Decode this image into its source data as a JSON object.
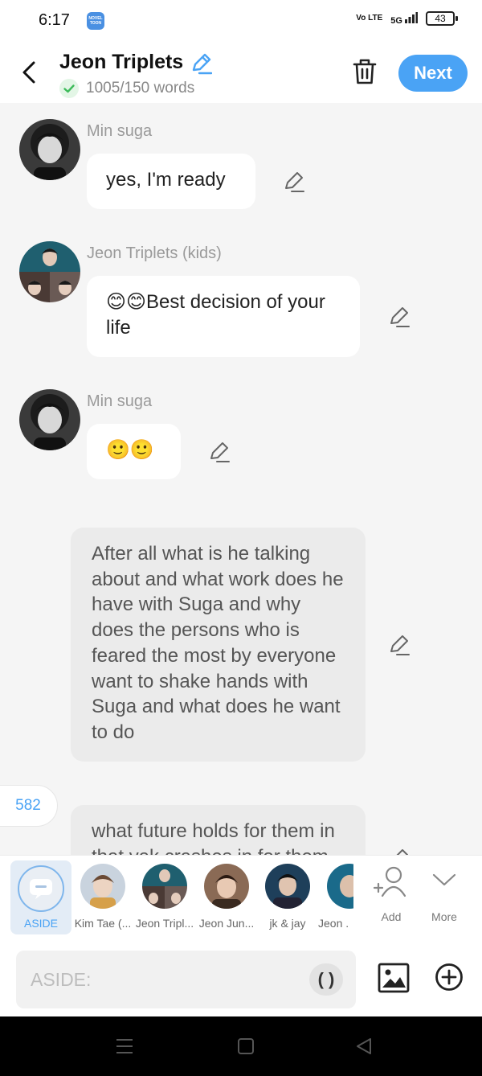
{
  "status_bar": {
    "time": "6:17",
    "app_badge": "NOVEL TOON",
    "volte": "Vo LTE",
    "network": "5G",
    "battery": "43"
  },
  "header": {
    "title": "Jeon Triplets",
    "word_count": "1005/150 words",
    "next_label": "Next"
  },
  "messages": [
    {
      "type": "character",
      "sender": "Min suga",
      "text": "yes, I'm ready"
    },
    {
      "type": "character",
      "sender": "Jeon Triplets (kids)",
      "text": "😊😊Best decision of your life"
    },
    {
      "type": "character",
      "sender": "Min suga",
      "text": "🙂🙂"
    },
    {
      "type": "aside",
      "text": "After all what is he talking about and what work does he have with Suga and why does the persons who is feared the most by everyone want to shake hands with Suga and what does he want to do"
    },
    {
      "type": "aside",
      "text": "what future holds for them in that yak crashes in for them"
    }
  ],
  "message_count": "582",
  "characters": {
    "aside_label": "ASIDE",
    "items": [
      {
        "name": "Kim Tae (..."
      },
      {
        "name": "Jeon Tripl..."
      },
      {
        "name": "Jeon Jun..."
      },
      {
        "name": "jk & jay"
      },
      {
        "name": "Jeon ."
      }
    ],
    "add_label": "Add",
    "more_label": "More"
  },
  "input": {
    "placeholder": "ASIDE:",
    "paren_label": "( )"
  }
}
